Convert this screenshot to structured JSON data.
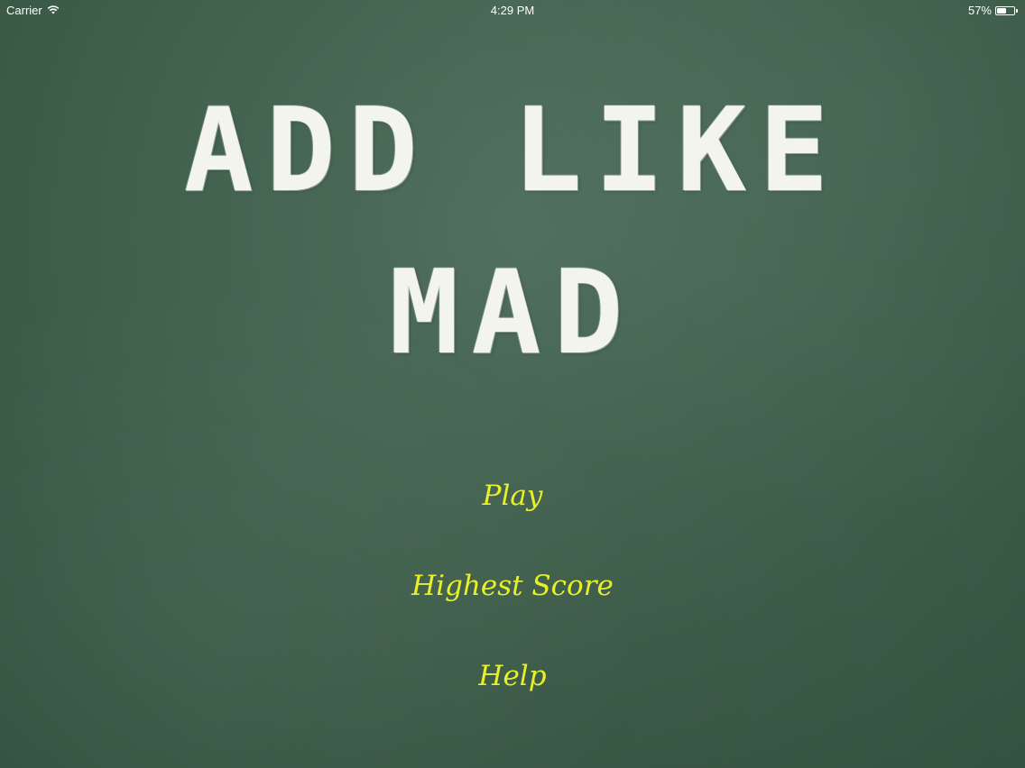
{
  "status_bar": {
    "carrier": "Carrier",
    "time": "4:29 PM",
    "battery_percent_text": "57%",
    "battery_level": 0.57,
    "wifi_icon": "wifi-icon",
    "battery_icon": "battery-icon"
  },
  "title": {
    "line1": "ADD LIKE",
    "line2": "MAD"
  },
  "menu": {
    "play": "Play",
    "highest_score": "Highest Score",
    "help": "Help"
  },
  "colors": {
    "background": "#43634f",
    "title": "#f4f4ef",
    "menu_text": "#e8f02a"
  }
}
